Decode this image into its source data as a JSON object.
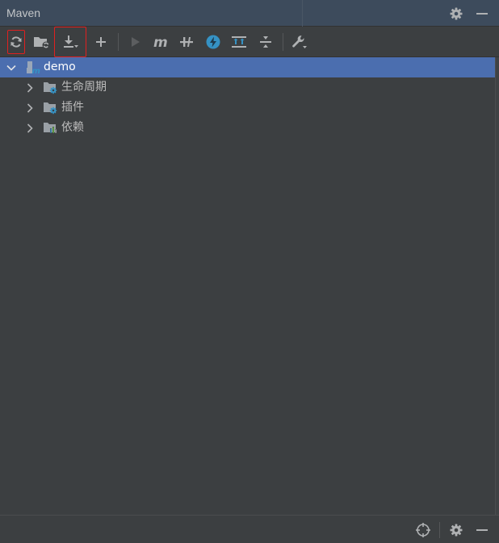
{
  "panel": {
    "title": "Maven"
  },
  "header": {
    "actions": [
      {
        "name": "settings",
        "icon": "gear-icon"
      },
      {
        "name": "hide",
        "icon": "minimize-icon"
      }
    ]
  },
  "toolbar": {
    "buttons": [
      {
        "icon": "reload-icon",
        "highlighted": true
      },
      {
        "icon": "folder-reload-icon",
        "highlighted": false
      },
      {
        "icon": "download-icon",
        "highlighted": true
      },
      {
        "icon": "add-icon",
        "highlighted": false
      },
      {
        "icon": "run-icon",
        "highlighted": false
      },
      {
        "icon": "maven-goal-icon",
        "highlighted": false
      },
      {
        "icon": "toggle-offline-icon",
        "highlighted": false
      },
      {
        "icon": "skip-tests-icon",
        "highlighted": false
      },
      {
        "icon": "show-dependencies-icon",
        "highlighted": false
      },
      {
        "icon": "collapse-all-icon",
        "highlighted": false
      },
      {
        "icon": "build-tools-settings-icon",
        "highlighted": false
      }
    ]
  },
  "tree": {
    "root": {
      "label": "demo",
      "expanded": true,
      "selected": true,
      "icon": "maven-module-icon"
    },
    "children": [
      {
        "label": "生命周期",
        "expanded": false,
        "icon": "lifecycle-folder-icon"
      },
      {
        "label": "插件",
        "expanded": false,
        "icon": "plugins-folder-icon"
      },
      {
        "label": "依赖",
        "expanded": false,
        "icon": "dependencies-folder-icon"
      }
    ]
  },
  "statusbar": {
    "actions": [
      {
        "name": "locate",
        "icon": "crosshair-icon"
      },
      {
        "name": "settings",
        "icon": "gear-icon"
      },
      {
        "name": "hide",
        "icon": "minimize-icon"
      }
    ]
  },
  "colors": {
    "header_bg": "#3d4b5c",
    "panel_bg": "#3c3f41",
    "selection": "#4b6eaf",
    "icon": "#afb1b3",
    "accent_blue": "#3592c4",
    "highlight_red": "#e02020"
  }
}
